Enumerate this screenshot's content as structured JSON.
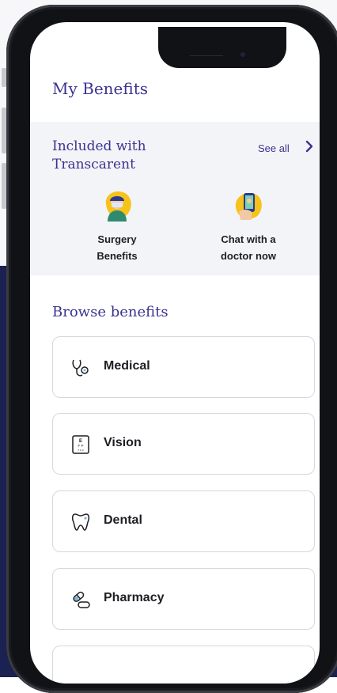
{
  "header": {
    "title": "My Benefits"
  },
  "included": {
    "title": "Included with Transcarent",
    "see_all": "See all",
    "tiles": [
      {
        "label_line1": "Surgery",
        "label_line2": "Benefits",
        "icon": "surgeon-icon"
      },
      {
        "label_line1": "Chat with a",
        "label_line2": "doctor now",
        "icon": "phone-chat-icon"
      }
    ]
  },
  "browse": {
    "title": "Browse benefits",
    "items": [
      {
        "label": "Medical",
        "icon": "stethoscope-icon"
      },
      {
        "label": "Vision",
        "icon": "eye-chart-icon",
        "icon_text": {
          "line1": "E",
          "line2": "F P",
          "line3": "T O Z"
        }
      },
      {
        "label": "Dental",
        "icon": "tooth-icon"
      },
      {
        "label": "Pharmacy",
        "icon": "pills-icon"
      }
    ]
  },
  "colors": {
    "accent": "#3a338f",
    "section_bg": "#f3f4f8",
    "backdrop_navy": "#1b2150",
    "icon_yellow": "#f7c21a",
    "card_border": "#d6d7df"
  }
}
